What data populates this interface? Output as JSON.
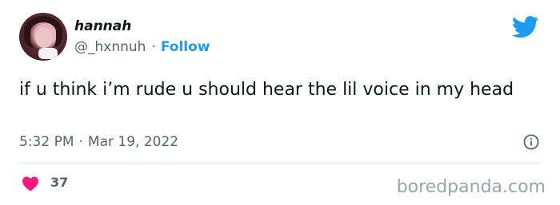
{
  "author": {
    "name": "hannah",
    "handle": "@_hxnnuh",
    "separator": "·",
    "follow_label": "Follow"
  },
  "tweet": {
    "text": "if u think i’m rude u should hear the lil voice in my head",
    "time": "5:32 PM",
    "separator": "·",
    "date": "Mar 19, 2022"
  },
  "engagement": {
    "likes": "37"
  },
  "watermark": "boredpanda.com",
  "icons": {
    "logo": "twitter-bird-icon",
    "info": "info-icon",
    "like": "heart-icon"
  },
  "colors": {
    "accent": "#1d9bf0",
    "like": "#f91880",
    "muted": "#536471"
  }
}
